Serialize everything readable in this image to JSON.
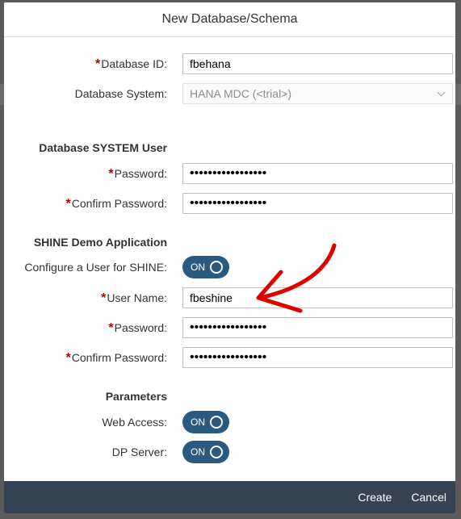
{
  "dialog": {
    "title": "New Database/Schema"
  },
  "fields": {
    "database_id": {
      "label": "Database ID:",
      "value": "fbehana"
    },
    "database_system": {
      "label": "Database System:",
      "value": "HANA MDC (<trial>)"
    }
  },
  "system_user": {
    "title": "Database SYSTEM User",
    "password": {
      "label": "Password:",
      "value": "•••••••••••••••••"
    },
    "confirm_password": {
      "label": "Confirm Password:",
      "value": "•••••••••••••••••"
    }
  },
  "shine": {
    "title": "SHINE Demo Application",
    "configure_user": {
      "label": "Configure a User for SHINE:",
      "state": "ON"
    },
    "user_name": {
      "label": "User Name:",
      "value": "fbeshine"
    },
    "password": {
      "label": "Password:",
      "value": "•••••••••••••••••"
    },
    "confirm_password": {
      "label": "Confirm Password:",
      "value": "•••••••••••••••••"
    }
  },
  "parameters": {
    "title": "Parameters",
    "web_access": {
      "label": "Web Access:",
      "state": "ON"
    },
    "dp_server": {
      "label": "DP Server:",
      "state": "ON"
    }
  },
  "footer": {
    "create_label": "Create",
    "cancel_label": "Cancel"
  },
  "colors": {
    "switch_on": "#2b5a80",
    "footer_bg": "#354452",
    "required": "#bb0000",
    "arrow": "#e00000"
  }
}
